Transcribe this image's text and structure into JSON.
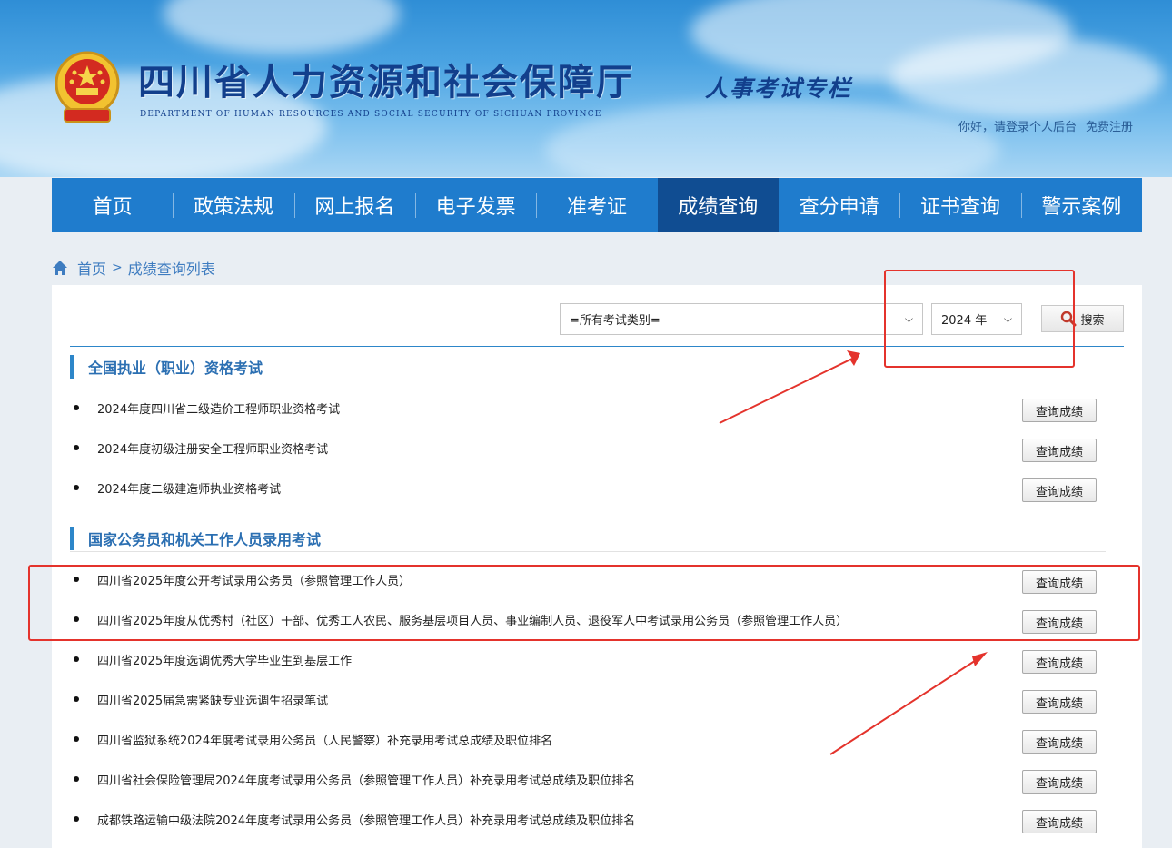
{
  "header": {
    "title_cn": "四川省人力资源和社会保障厅",
    "title_en": "DEPARTMENT OF HUMAN RESOURCES AND SOCIAL SECURITY OF SICHUAN PROVINCE",
    "subtitle": "人事考试专栏",
    "greeting": "你好，请登录个人后台",
    "register": "免费注册"
  },
  "nav": {
    "items": [
      {
        "label": "首页"
      },
      {
        "label": "政策法规"
      },
      {
        "label": "网上报名"
      },
      {
        "label": "电子发票"
      },
      {
        "label": "准考证"
      },
      {
        "label": "成绩查询",
        "active": true
      },
      {
        "label": "查分申请"
      },
      {
        "label": "证书查询"
      },
      {
        "label": "警示案例"
      }
    ]
  },
  "breadcrumb": {
    "home": "首页",
    "separator": ">",
    "current": "成绩查询列表"
  },
  "filters": {
    "category_value": "=所有考试类别=",
    "year_value": "2024 年",
    "search_label": "搜索"
  },
  "sections": [
    {
      "title": "全国执业（职业）资格考试",
      "items": [
        {
          "title": "2024年度四川省二级造价工程师职业资格考试",
          "button": "查询成绩"
        },
        {
          "title": "2024年度初级注册安全工程师职业资格考试",
          "button": "查询成绩"
        },
        {
          "title": "2024年度二级建造师执业资格考试",
          "button": "查询成绩"
        }
      ]
    },
    {
      "title": "国家公务员和机关工作人员录用考试",
      "items": [
        {
          "title": "四川省2025年度公开考试录用公务员（参照管理工作人员）",
          "button": "查询成绩"
        },
        {
          "title": "四川省2025年度从优秀村（社区）干部、优秀工人农民、服务基层项目人员、事业编制人员、退役军人中考试录用公务员（参照管理工作人员）",
          "button": "查询成绩"
        },
        {
          "title": "四川省2025年度选调优秀大学毕业生到基层工作",
          "button": "查询成绩"
        },
        {
          "title": "四川省2025届急需紧缺专业选调生招录笔试",
          "button": "查询成绩"
        },
        {
          "title": "四川省监狱系统2024年度考试录用公务员（人民警察）补充录用考试总成绩及职位排名",
          "button": "查询成绩"
        },
        {
          "title": "四川省社会保险管理局2024年度考试录用公务员（参照管理工作人员）补充录用考试总成绩及职位排名",
          "button": "查询成绩"
        },
        {
          "title": "成都铁路运输中级法院2024年度考试录用公务员（参照管理工作人员）补充录用考试总成绩及职位排名",
          "button": "查询成绩"
        }
      ]
    }
  ],
  "colors": {
    "nav_bg": "#1f7ccd",
    "nav_active": "#104d92",
    "accent": "#2d86c9",
    "annotation_red": "#e4332c"
  }
}
